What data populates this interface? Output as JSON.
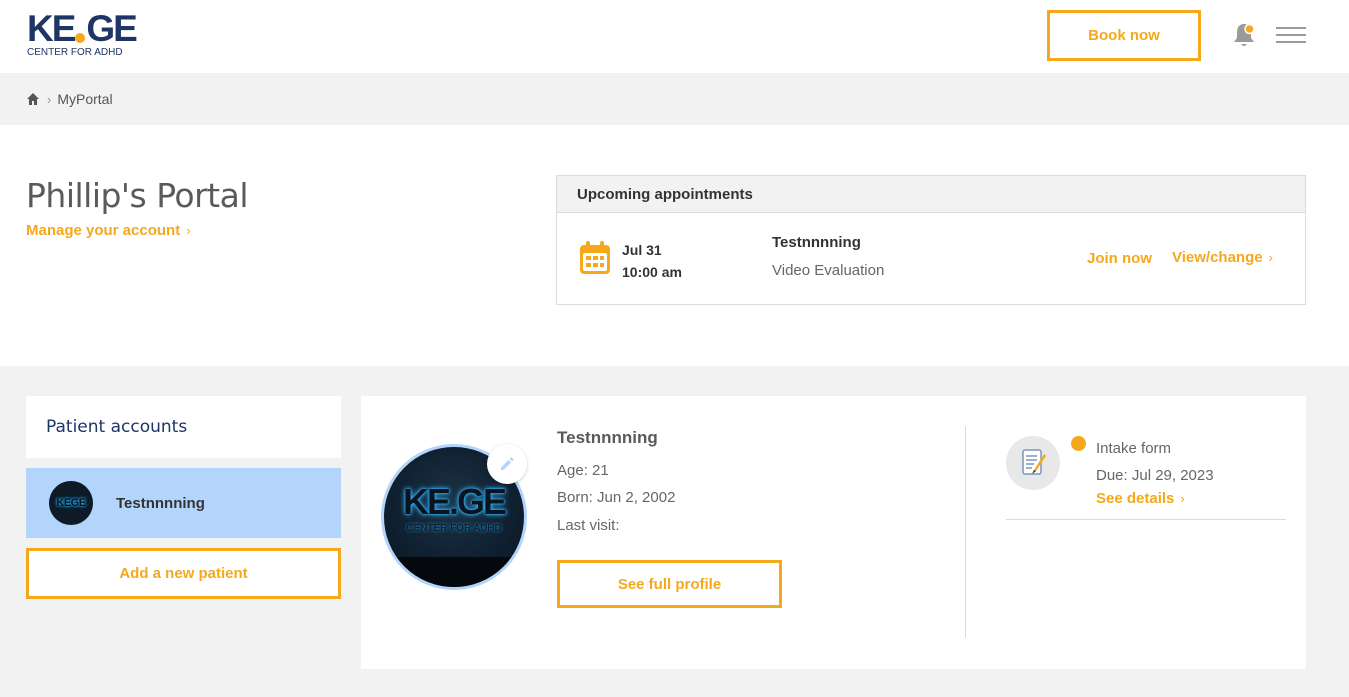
{
  "header": {
    "logo_main": "KEGE",
    "logo_sub": "CENTER FOR ADHD",
    "book_now_label": "Book now",
    "brand_color": "#f6a81c",
    "navy_color": "#1e3566"
  },
  "breadcrumb": {
    "items": [
      "MyPortal"
    ]
  },
  "portal": {
    "title": "Phillip's Portal",
    "manage_label": "Manage your account"
  },
  "appointments": {
    "heading": "Upcoming appointments",
    "items": [
      {
        "date": "Jul 31",
        "time": "10:00 am",
        "patient": "Testnnnning",
        "type": "Video Evaluation",
        "join_label": "Join now",
        "view_label": "View/change"
      }
    ]
  },
  "patient_accounts": {
    "heading": "Patient accounts",
    "items": [
      {
        "name": "Testnnnning",
        "avatar_text": "KEGE",
        "selected": true
      }
    ],
    "add_label": "Add a new patient"
  },
  "profile": {
    "name": "Testnnnning",
    "age": "Age: 21",
    "born": "Born: Jun 2, 2002",
    "last_visit": "Last visit:",
    "avatar_logo": "KE.GE",
    "avatar_sub": "CENTER FOR ADHD",
    "see_full_label": "See full profile"
  },
  "tasks": [
    {
      "title": "Intake form",
      "due": "Due: Jul 29, 2023",
      "link_label": "See details"
    }
  ]
}
